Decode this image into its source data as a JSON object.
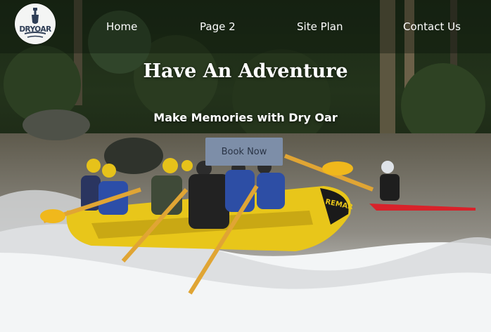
{
  "logo": {
    "text": "DRYOAR"
  },
  "nav": {
    "items": [
      {
        "label": "Home"
      },
      {
        "label": "Page 2"
      },
      {
        "label": "Site Plan"
      },
      {
        "label": "Contact Us"
      }
    ]
  },
  "hero": {
    "title": "Have An Adventure",
    "subtitle": "Make Memories with Dry Oar",
    "cta_label": "Book Now",
    "raft_brand": "REMAR"
  },
  "colors": {
    "button_bg": "#7d8ea8",
    "button_text": "#2a3446",
    "raft_yellow": "#e8c61a",
    "logo_navy": "#2f3e56"
  }
}
